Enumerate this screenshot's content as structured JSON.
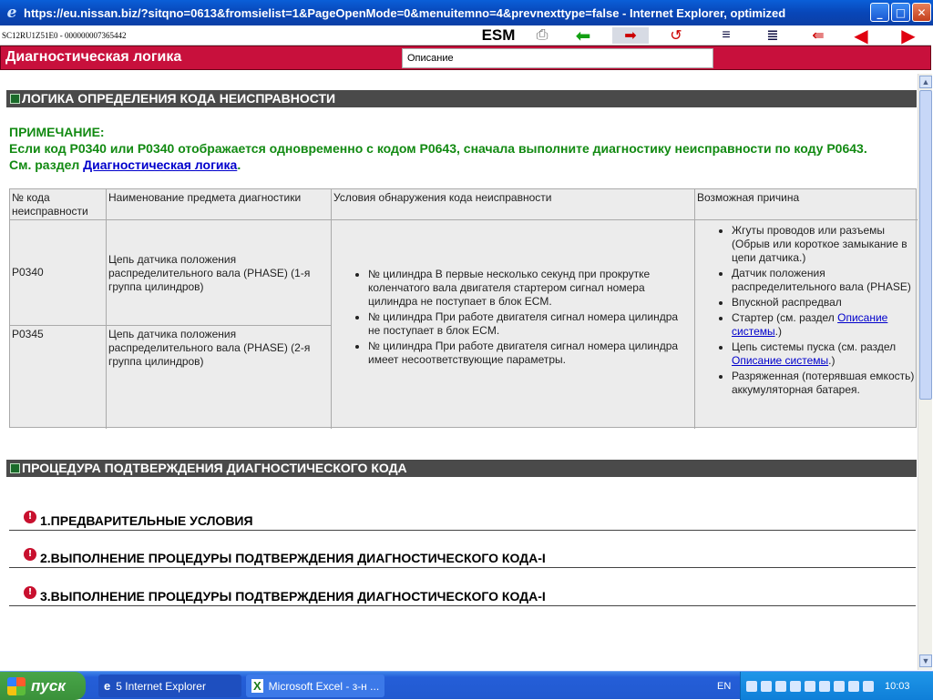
{
  "window": {
    "title": "https://eu.nissan.biz/?sitqno=0613&fromsielist=1&PageOpenMode=0&menuitemno=4&prevnexttype=false - Internet Explorer, optimized",
    "min": "_",
    "max": "□",
    "close": "✕"
  },
  "toolbar": {
    "doc_id": "SC12RU1Z51E0 - 000000007365442",
    "esm": "ESM",
    "icons": [
      "print-icon",
      "back-green-arrow-icon",
      "next-page-icon",
      "copy-page-icon",
      "expand-icon",
      "collapse-icon",
      "prev-page-icon",
      "prev-red-arrow-icon",
      "next-red-arrow-icon"
    ]
  },
  "header": {
    "title": "Диагностическая логика",
    "section_select": "Описание"
  },
  "section1": {
    "heading": "ЛОГИКА ОПРЕДЕЛЕНИЯ КОДА НЕИСПРАВНОСТИ",
    "note_label": "ПРИМЕЧАНИЕ:",
    "note_text": "Если код P0340 или P0340 отображается одновременно с кодом P0643, сначала выполните диагностику неисправности по коду P0643.",
    "note_see": "См. раздел ",
    "note_link": "Диагностическая логика",
    "note_end": "."
  },
  "table": {
    "headers": [
      "№ кода неисправности",
      "Наименование предмета диагностики",
      "Условия обнаружения кода неисправности",
      "Возможная причина"
    ],
    "rows": [
      {
        "code": "P0340",
        "name": "Цепь датчика положения распределительного вала (PHASE) (1-я группа цилиндров)"
      },
      {
        "code": "P0345",
        "name": "Цепь датчика положения распределительного вала (PHASE) (2-я группа цилиндров)"
      }
    ],
    "conditions": [
      "№ цилиндра В первые несколько секунд при прокрутке коленчатого вала двигателя стартером сигнал номера цилиндра не поступает в блок ECM.",
      "№ цилиндра При работе двигателя сигнал номера цилиндра не поступает в блок ECM.",
      "№ цилиндра При работе двигателя сигнал номера цилиндра имеет несоответствующие параметры."
    ],
    "causes": [
      "Жгуты проводов или разъемы (Обрыв или короткое замыкание в цепи датчика.)",
      "Датчик положения распределительного вала (PHASE)",
      "Впускной распредвал"
    ],
    "cause_starter": "Стартер (см. раздел ",
    "cause_starter_link": "Описание системы",
    "cause_starter_end": ".)",
    "cause_start_circuit": "Цепь системы пуска (см. раздел ",
    "cause_start_circuit_link": "Описание системы",
    "cause_start_circuit_end": ".)",
    "cause_battery": "Разряженная (потерявшая емкость) аккумуляторная батарея."
  },
  "section2": {
    "heading": "ПРОЦЕДУРА ПОДТВЕРЖДЕНИЯ ДИАГНОСТИЧЕСКОГО КОДА",
    "items": [
      "1.ПРЕДВАРИТЕЛЬНЫЕ УСЛОВИЯ",
      "2.ВЫПОЛНЕНИЕ ПРОЦЕДУРЫ ПОДТВЕРЖДЕНИЯ ДИАГНОСТИЧЕСКОГО КОДА-I",
      "3.ВЫПОЛНЕНИЕ ПРОЦЕДУРЫ ПОДТВЕРЖДЕНИЯ ДИАГНОСТИЧЕСКОГО КОДА-I"
    ]
  },
  "taskbar": {
    "start": "пуск",
    "tasks": [
      {
        "label": "5 Internet Explorer",
        "icon": "ie-icon",
        "color": "#1e4fbf"
      },
      {
        "label": "Microsoft Excel - з-н ...",
        "icon": "excel-icon",
        "color": "#3c79e8"
      }
    ],
    "lang": "EN",
    "clock": "10:03"
  }
}
